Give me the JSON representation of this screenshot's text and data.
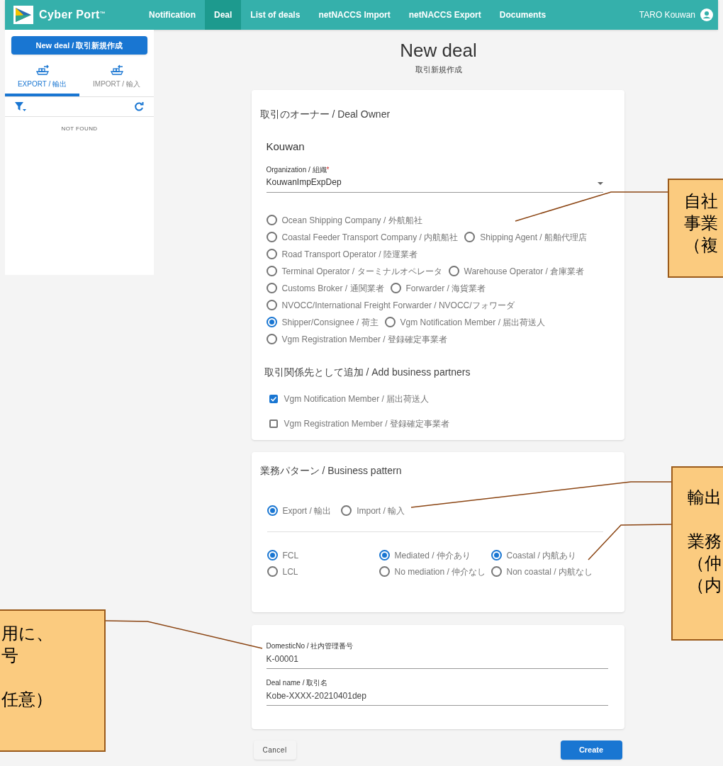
{
  "nav": {
    "brand": "Cyber Port",
    "brand_mark": "™",
    "items": [
      {
        "label": "Notification",
        "selected": false
      },
      {
        "label": "Deal",
        "selected": true
      },
      {
        "label": "List of deals",
        "selected": false
      },
      {
        "label": "netNACCS Import",
        "selected": false
      },
      {
        "label": "netNACCS Export",
        "selected": false
      },
      {
        "label": "Documents",
        "selected": false
      }
    ],
    "user": "TARO Kouwan"
  },
  "sidebar": {
    "new_button": "New deal / 取引新規作成",
    "tabs": [
      {
        "label": "EXPORT / 輸出",
        "kind": "export",
        "selected": true
      },
      {
        "label": "IMPORT / 輸入",
        "kind": "import",
        "selected": false
      }
    ],
    "empty": "NOT FOUND"
  },
  "page": {
    "title": "New deal",
    "subtitle": "取引新規作成"
  },
  "owner": {
    "heading": "取引のオーナー / Deal Owner",
    "company": "Kouwan",
    "org_label": "Organization / 組織",
    "required_mark": "*",
    "org_value": "KouwanImpExpDep",
    "roles": [
      [
        {
          "label": "Ocean Shipping Company / 外航船社",
          "selected": false
        }
      ],
      [
        {
          "label": "Coastal Feeder Transport Company / 内航船社",
          "selected": false
        },
        {
          "label": "Shipping Agent / 船舶代理店",
          "selected": false
        }
      ],
      [
        {
          "label": "Road Transport Operator / 陸運業者",
          "selected": false
        }
      ],
      [
        {
          "label": "Terminal Operator / ターミナルオペレータ",
          "selected": false
        },
        {
          "label": "Warehouse Operator / 倉庫業者",
          "selected": false
        }
      ],
      [
        {
          "label": "Customs Broker / 通関業者",
          "selected": false
        },
        {
          "label": "Forwarder / 海貨業者",
          "selected": false
        }
      ],
      [
        {
          "label": "NVOCC/International Freight Forwarder / NVOCC/フォワーダ",
          "selected": false
        }
      ],
      [
        {
          "label": "Shipper/Consignee / 荷主",
          "selected": true
        },
        {
          "label": "Vgm Notification Member / 届出荷送人",
          "selected": false
        }
      ],
      [
        {
          "label": "Vgm Registration Member / 登録確定事業者",
          "selected": false
        }
      ]
    ],
    "partners_heading": "取引関係先として追加 / Add business partners",
    "partners": [
      {
        "label": "Vgm Notification Member / 届出荷送人",
        "checked": true
      },
      {
        "label": "Vgm Registration Member / 登録確定事業者",
        "checked": false
      }
    ]
  },
  "pattern": {
    "heading": "業務パターン / Business pattern",
    "direction": [
      {
        "label": "Export / 輸出",
        "selected": true
      },
      {
        "label": "Import / 輸入",
        "selected": false
      }
    ],
    "groups": [
      [
        {
          "label": "FCL",
          "selected": true
        },
        {
          "label": "LCL",
          "selected": false
        }
      ],
      [
        {
          "label": "Mediated / 仲介あり",
          "selected": true
        },
        {
          "label": "No mediation / 仲介なし",
          "selected": false
        }
      ],
      [
        {
          "label": "Coastal / 内航あり",
          "selected": true
        },
        {
          "label": "Non coastal / 内航なし",
          "selected": false
        }
      ]
    ]
  },
  "details": {
    "fields": [
      {
        "label": "DomesticNo / 社内管理番号",
        "value": "K-00001"
      },
      {
        "label": "Deal name / 取引名",
        "value": "Kobe-XXXX-20210401dep"
      }
    ]
  },
  "actions": {
    "cancel": "Cancel",
    "create": "Create"
  },
  "callouts": [
    {
      "paragraphs": [
        [
          "自社",
          "事業",
          "（複"
        ]
      ]
    },
    {
      "paragraphs": [
        [
          "輸出"
        ],
        [
          "業務",
          "（仲",
          "（内"
        ]
      ]
    },
    {
      "paragraphs": [
        [
          "用に、",
          "号"
        ],
        [
          "任意）"
        ]
      ]
    }
  ]
}
